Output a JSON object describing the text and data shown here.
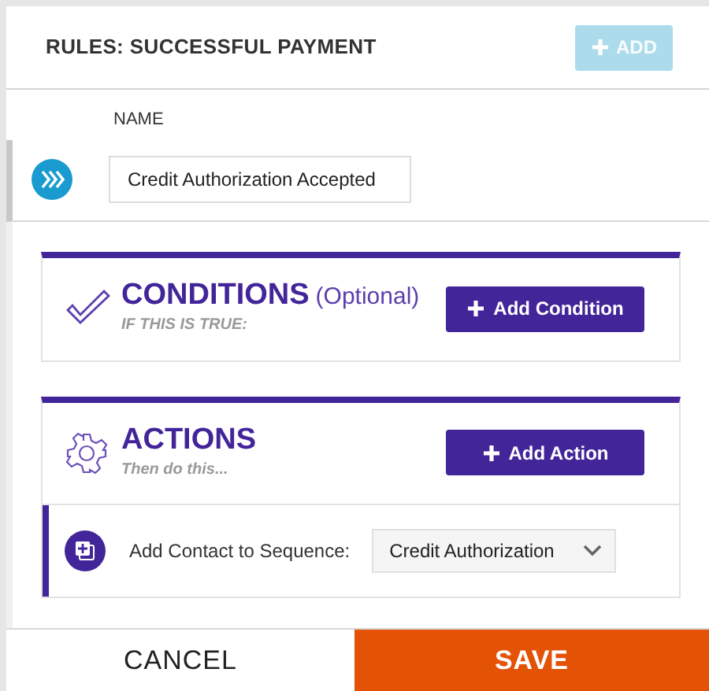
{
  "header": {
    "title": "RULES: SUCCESSFUL PAYMENT",
    "add_button": {
      "label": "ADD",
      "disabled": true
    }
  },
  "name_field": {
    "label": "NAME",
    "value": "Credit Authorization Accepted"
  },
  "conditions": {
    "title": "CONDITIONS",
    "note": "(Optional)",
    "subtitle": "IF THIS IS TRUE:",
    "button": "Add Condition"
  },
  "actions": {
    "title": "ACTIONS",
    "subtitle": "Then do this...",
    "button": "Add Action",
    "items": [
      {
        "label": "Add Contact to Sequence:",
        "value": "Credit Authorization"
      }
    ]
  },
  "footer": {
    "cancel": "CANCEL",
    "save": "SAVE"
  }
}
